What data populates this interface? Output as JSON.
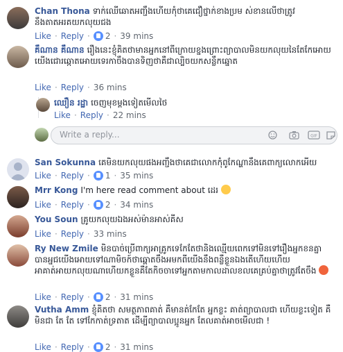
{
  "comments": [
    {
      "name": "Chan Thona",
      "text": "ទាក់ឈើឆោតអញ្ជឹងហើយកុំថាគេជឿថ្នាក់ខាងប្រម ស់ខានលើថាត្រូវនឹងតាតអរគយកលុយជង",
      "like": "Like",
      "reply": "Reply",
      "likes": "2",
      "time": "39 mins"
    },
    {
      "name": "គឹណាន គឹណាន",
      "text": "រឿងនេះខ្ញុំគិតថាមានអ្នកនៅពីក្រោយខ្នងព្រោះព្យាបាលមិនយកលុយនៃតែកែអោយយើងជោរឆ្កោតអោយទេរកាចឹងបានទិញថាគឺជាល្បិចយកសន្លឹកឆ្នោត",
      "like": "Like",
      "reply": "Reply",
      "time": "36 mins"
    },
    {
      "name": "ឈឿន រដ្ឋា",
      "text": "ចេញមុខម្តងទៀតមើលថៃ",
      "like": "Like",
      "reply": "Reply",
      "time": "22 mins"
    },
    {
      "name": "San Sokunna",
      "text": "គេមិនយកលុយផងអញ្ជឹងថាគេជាលោកកុំពូកែណ្ហានឹងគេពាក្យលោកអើយ",
      "like": "Like",
      "reply": "Reply",
      "likes": "1",
      "time": "35 mins"
    },
    {
      "name": "Mrr Kong",
      "text": "I'm here read comment about ដេរ",
      "like": "Like",
      "reply": "Reply",
      "likes": "2",
      "time": "34 mins"
    },
    {
      "name": "You Soun",
      "text": "គ្រូយកលុយឯងអស់ម៉ានអាស់គីស",
      "like": "Like",
      "reply": "Reply",
      "time": "33 mins"
    },
    {
      "name": "Ry New Zmile",
      "text": "មិនបាច់ប្រើពាក្យអាគ្រូកទេកែតែថានិងឈ្មើយពេកទៅមិនទៅរឿងអ្នកខនគ្នាបានអ្នជយើងអោយទៅណាមិចក៍ថាឆ្ពោតចឹងអមកពីយើងនឹងពន្លឺខ្លួនឯងតើហើយហើយអាគាត់អាយកលុយណាហើយកខ្លួនគឺតែកិចចាទៅអ្នកតាមកាលដាលខលគេគ្រប់គ្នាថាត្រូវតែចឹង",
      "like": "Like",
      "reply": "Reply",
      "likes": "2",
      "time": "31 mins"
    },
    {
      "name": "Vutha Amm",
      "text": "ខ្ញុំគិតថា សមត្ថភាពគាត់ គឺមានត់កែតែ អ្នកខ្លះ គាត់ព្យាបាលជា ហើយខ្លះទៀត គឺមិនជា តែ តែ ទៅកែកាត់ទ្រតាត ដើម្បីព្យាបាលប្អូនអ្នក តែលគាត់អាចមើលជា !",
      "like": "Like",
      "reply": "Reply",
      "likes": "2",
      "time": "31 mins"
    }
  ],
  "reply_box": {
    "placeholder": "Write a reply..."
  }
}
